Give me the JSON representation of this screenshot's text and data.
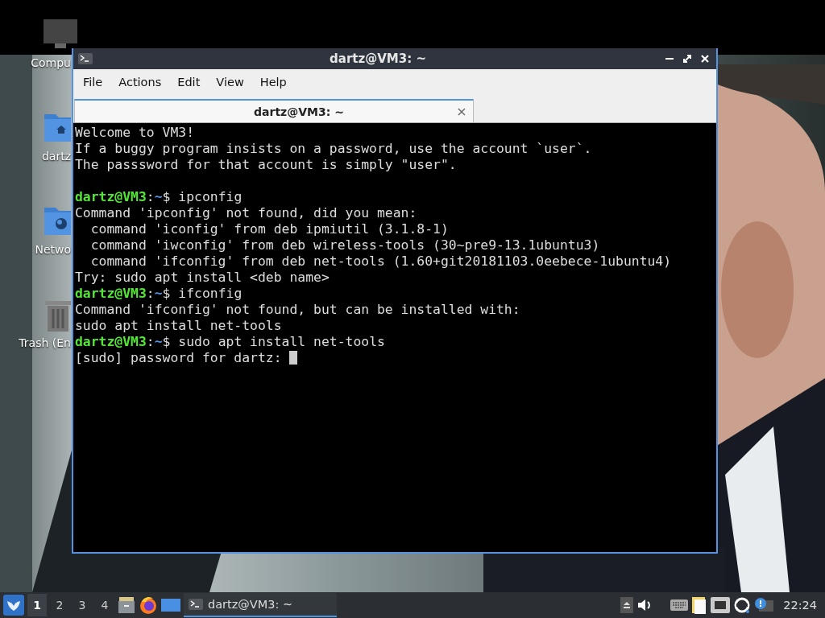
{
  "desktop_icons": [
    {
      "kind": "computer",
      "label": "Compu"
    },
    {
      "kind": "home",
      "label": "dartz"
    },
    {
      "kind": "network",
      "label": "Netwo"
    },
    {
      "kind": "trash",
      "label": "Trash (En"
    }
  ],
  "window": {
    "title": "dartz@VM3: ~",
    "menu": [
      "File",
      "Actions",
      "Edit",
      "View",
      "Help"
    ],
    "tabs": [
      {
        "label": "dartz@VM3: ~",
        "selected": true,
        "close": "×"
      }
    ],
    "terminal_lines": [
      {
        "kind": "output",
        "text": "Welcome to VM3!"
      },
      {
        "kind": "output",
        "text": "If a buggy program insists on a password, use the account `user`."
      },
      {
        "kind": "output",
        "text": "The passsword for that account is simply \"user\"."
      },
      {
        "kind": "blank"
      },
      {
        "kind": "prompt",
        "user_host": "dartz@VM3",
        "separator": ":",
        "path": "~",
        "symbol": "$",
        "command": "ipconfig"
      },
      {
        "kind": "output",
        "text": "Command 'ipconfig' not found, did you mean:"
      },
      {
        "kind": "output",
        "text": "  command 'iconfig' from deb ipmiutil (3.1.8-1)"
      },
      {
        "kind": "output",
        "text": "  command 'iwconfig' from deb wireless-tools (30~pre9-13.1ubuntu3)"
      },
      {
        "kind": "output",
        "text": "  command 'ifconfig' from deb net-tools (1.60+git20181103.0eebece-1ubuntu4)"
      },
      {
        "kind": "output",
        "text": "Try: sudo apt install <deb name>"
      },
      {
        "kind": "prompt",
        "user_host": "dartz@VM3",
        "separator": ":",
        "path": "~",
        "symbol": "$",
        "command": "ifconfig"
      },
      {
        "kind": "output",
        "text": "Command 'ifconfig' not found, but can be installed with:"
      },
      {
        "kind": "output",
        "text": "sudo apt install net-tools"
      },
      {
        "kind": "prompt",
        "user_host": "dartz@VM3",
        "separator": ":",
        "path": "~",
        "symbol": "$",
        "command": "sudo apt install net-tools"
      },
      {
        "kind": "output",
        "text": "[sudo] password for dartz: ",
        "cursor": true
      }
    ]
  },
  "taskbar": {
    "workspaces": [
      {
        "label": "1",
        "selected": true
      },
      {
        "label": "2",
        "selected": false
      },
      {
        "label": "3",
        "selected": false
      },
      {
        "label": "4",
        "selected": false
      }
    ],
    "tasks": [
      {
        "label": "dartz@VM3: ~",
        "selected": true
      }
    ],
    "clock": "22:24"
  }
}
